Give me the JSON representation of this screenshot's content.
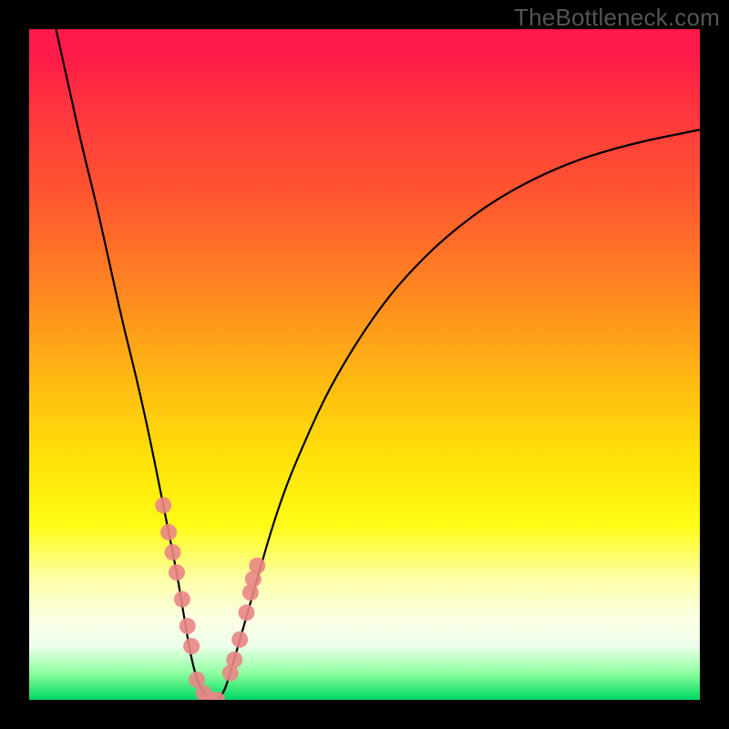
{
  "watermark": "TheBottleneck.com",
  "chart_data": {
    "type": "line",
    "title": "",
    "xlabel": "",
    "ylabel": "",
    "xlim": [
      0,
      100
    ],
    "ylim": [
      0,
      100
    ],
    "series": [
      {
        "name": "bottleneck-curve",
        "x": [
          4,
          6,
          8,
          10,
          12,
          14,
          16,
          18,
          20,
          21,
          22,
          23,
          24,
          25,
          26,
          27,
          28,
          29,
          30,
          32,
          34,
          36,
          38,
          40,
          44,
          48,
          52,
          56,
          62,
          70,
          80,
          90,
          100
        ],
        "y": [
          100,
          91,
          82,
          74,
          65,
          56,
          48,
          39,
          29,
          24,
          19,
          13,
          7,
          3,
          1,
          0,
          0,
          1,
          4,
          11,
          18,
          25,
          31,
          36,
          45,
          52,
          58,
          63,
          69,
          75,
          80,
          83,
          85
        ]
      }
    ],
    "scatter_points": {
      "name": "highlighted-range",
      "color": "#e98686",
      "x": [
        20.0,
        20.8,
        21.4,
        22.0,
        22.8,
        23.6,
        24.2,
        25.0,
        26.0,
        27.0,
        28.0,
        30.0,
        30.6,
        31.4,
        32.4,
        33.0,
        33.4,
        34.0
      ],
      "y": [
        29.0,
        25.0,
        22.0,
        19.0,
        15.0,
        11.0,
        8.0,
        3.0,
        1.0,
        0.0,
        0.0,
        4.0,
        6.0,
        9.0,
        13.0,
        16.0,
        18.0,
        20.0
      ]
    },
    "gradient_colors": {
      "top": "#ff1a4a",
      "mid1": "#ff8a1f",
      "mid2": "#ffe209",
      "bottom": "#00d66a"
    }
  }
}
